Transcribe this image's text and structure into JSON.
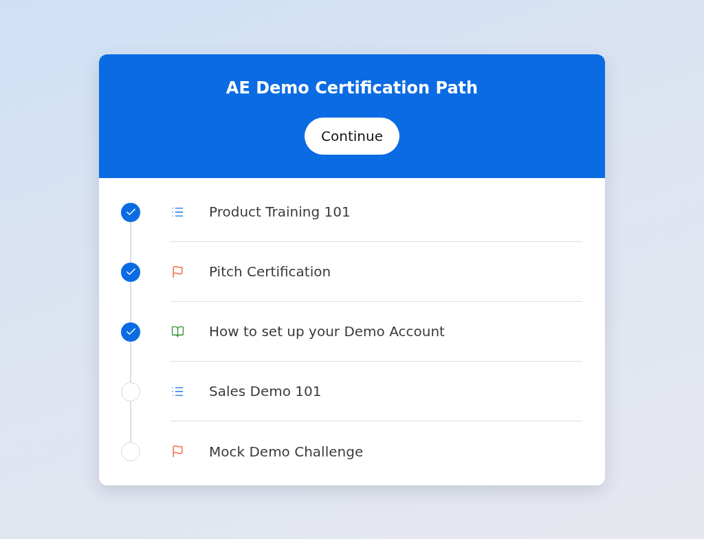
{
  "header": {
    "title": "AE Demo Certification Path",
    "button": "Continue"
  },
  "steps": [
    {
      "kind": "list",
      "label": "Product Training 101",
      "completed": true
    },
    {
      "kind": "flag",
      "label": "Pitch Certification",
      "completed": true
    },
    {
      "kind": "book",
      "label": "How to set up your Demo Account",
      "completed": true
    },
    {
      "kind": "list",
      "label": "Sales Demo 101",
      "completed": false
    },
    {
      "kind": "flag",
      "label": "Mock Demo Challenge",
      "completed": false
    }
  ]
}
